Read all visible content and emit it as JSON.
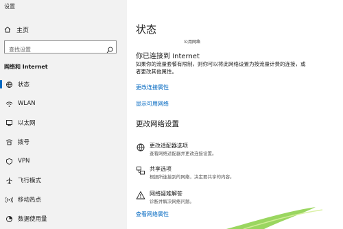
{
  "window": {
    "title": "设置"
  },
  "sidebar": {
    "home_label": "主页",
    "search_placeholder": "查找设置",
    "section_title": "网络和 Internet",
    "items": [
      {
        "label": "状态",
        "icon": "status-icon",
        "active": true
      },
      {
        "label": "WLAN",
        "icon": "wifi-icon"
      },
      {
        "label": "以太网",
        "icon": "ethernet-icon"
      },
      {
        "label": "拨号",
        "icon": "dialup-icon"
      },
      {
        "label": "VPN",
        "icon": "vpn-icon"
      },
      {
        "label": "飞行模式",
        "icon": "airplane-icon"
      },
      {
        "label": "移动热点",
        "icon": "hotspot-icon"
      },
      {
        "label": "数据使用量",
        "icon": "data-usage-icon"
      }
    ]
  },
  "main": {
    "title": "状态",
    "network_name": "公用网络",
    "connected_heading": "你已连接到 Internet",
    "connected_desc": "如果你的流量套餐有限制，则你可以将此网络设置为按流量计费的连接，或者更改其他属性。",
    "link_change_properties": "更改连接属性",
    "link_show_networks": "显示可用网络",
    "change_heading": "更改网络设置",
    "options": [
      {
        "title": "更改适配器选项",
        "desc": "查看网络适配器并更改连接设置。",
        "icon": "adapter-icon"
      },
      {
        "title": "共享选项",
        "desc": "根据所连接到的网络，决定要共享的内容。",
        "icon": "sharing-icon"
      },
      {
        "title": "网络疑难解答",
        "desc": "诊断并解决网络问题。",
        "icon": "troubleshoot-warning-icon"
      }
    ],
    "link_hardware_properties": "查看网络属性"
  },
  "colors": {
    "accent": "#0067c0",
    "sidebar_bg": "#f2f2f2",
    "decor_arrow": "#8fd14f"
  }
}
